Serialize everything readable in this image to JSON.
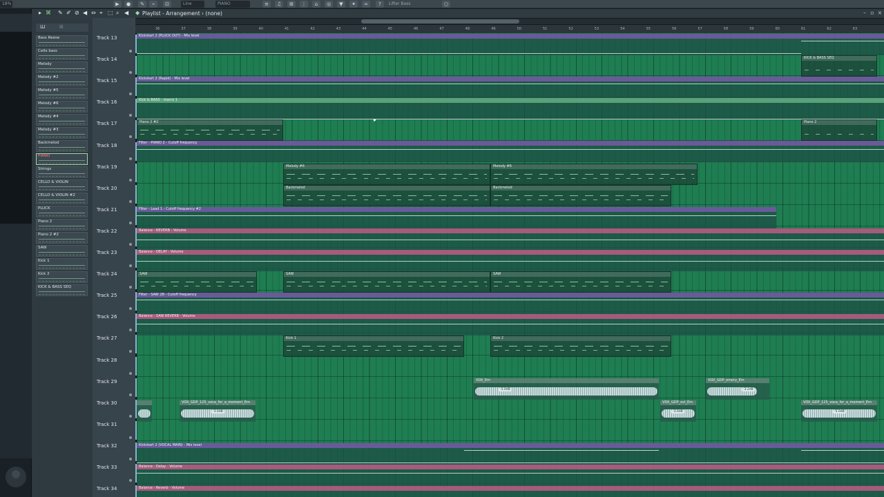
{
  "toolbar": {
    "pattern_field": "PIANO",
    "line_field": "Line",
    "hint_text": "Lifter Bass",
    "cpu": "18%"
  },
  "playlist": {
    "title": "Playlist - Arrangement › (none)"
  },
  "picker_tabs": [
    "Ш",
    "⊞"
  ],
  "patterns": [
    {
      "name": "Bass Reese",
      "selected": false
    },
    {
      "name": "Cello bass",
      "selected": false
    },
    {
      "name": "Melody",
      "selected": false
    },
    {
      "name": "Melody #2",
      "selected": false
    },
    {
      "name": "Melody #5",
      "selected": false
    },
    {
      "name": "Melody #6",
      "selected": false
    },
    {
      "name": "Melody #4",
      "selected": false
    },
    {
      "name": "Melody #3",
      "selected": false
    },
    {
      "name": "Backmelod",
      "selected": false
    },
    {
      "name": "PIANO",
      "selected": true
    },
    {
      "name": "Strings",
      "selected": false
    },
    {
      "name": "CELLO & VIOLIN",
      "selected": false
    },
    {
      "name": "CELLO & VIOLIN #2",
      "selected": false
    },
    {
      "name": "PLUCK",
      "selected": false
    },
    {
      "name": "Piano 2",
      "selected": false
    },
    {
      "name": "Piano 2 #2",
      "selected": false
    },
    {
      "name": "SAW",
      "selected": false
    },
    {
      "name": "Kick 1",
      "selected": false
    },
    {
      "name": "Kick 2",
      "selected": false
    },
    {
      "name": "KICK & BASS SEQ",
      "selected": false
    }
  ],
  "tracks": [
    "Track 13",
    "Track 14",
    "Track 15",
    "Track 16",
    "Track 17",
    "Track 18",
    "Track 19",
    "Track 20",
    "Track 21",
    "Track 22",
    "Track 23",
    "Track 24",
    "Track 25",
    "Track 26",
    "Track 27",
    "Track 28",
    "Track 29",
    "Track 30",
    "Track 31",
    "Track 32",
    "Track 33",
    "Track 34"
  ],
  "bar_numbers": [
    "36",
    "37",
    "38",
    "39",
    "40",
    "41",
    "42",
    "43",
    "44",
    "45",
    "46",
    "47",
    "48",
    "49",
    "50",
    "51",
    "52",
    "53",
    "54",
    "55",
    "56",
    "57",
    "58",
    "59",
    "60",
    "61",
    "62",
    "63"
  ],
  "clips": {
    "t13_auto": "Kickstart 2 (PLUCK OUT) - Mix level",
    "t14_seq": "KICK & BASS SEQ",
    "t15_auto": "Kickstart 2 (Rapid) - Mix level",
    "t16_auto": "Kick & BASS - macro 1",
    "t17_p1": "Piano 2 #2",
    "t17_p2": "Piano 2",
    "t18_auto": "Filter - PIANO 2 - Cutoff frequency",
    "t19_m1": "Melody #6",
    "t19_m2": "Melody #6",
    "t20_b1": "Backmelod",
    "t20_b2": "Backmelod",
    "t21_auto": "Filter - Lead 1 - Cutoff frequency #2",
    "t22_auto": "Balance - REVERB - Volume",
    "t23_auto": "Balance - DELAY - Volume",
    "t24_s1": "SAW",
    "t24_s2": "SAW",
    "t24_s3": "SAW",
    "t25_auto": "Filter - SAW 2B - Cutoff frequency",
    "t26_auto": "Balance - SAW REVERB - Volume",
    "t27_k1": "Kick 1",
    "t27_k2": "Kick 2",
    "t29_a1": "VOX_Em",
    "t29_a2": "VOX_GDP_emory_Em",
    "t30_a1": "VOX_GDP_125_voca_for_a_moment_Em",
    "t30_a2": "VOX_GDP_ovl_Em",
    "t30_a3": "VOX_GDP_125_voca_for_a_moment_Em",
    "t32_auto": "Kickstart 2 (VOCAL MAIN) - Mix level",
    "t33_auto": "Balance - Delay - Volume",
    "t34_auto": "Balance - Reverb - Volume"
  },
  "gains": {
    "g1": "-5.0dB",
    "g2": "-3.0dB",
    "g3": "-3.0dB",
    "g4": "-5.0dB",
    "g5": "-3.2dB"
  },
  "colors": {
    "grid": "#1f7d52",
    "automation_purple": "#6a5a9a",
    "automation_pink": "#a85a7c",
    "selected_pattern": "#ff7d7d"
  }
}
